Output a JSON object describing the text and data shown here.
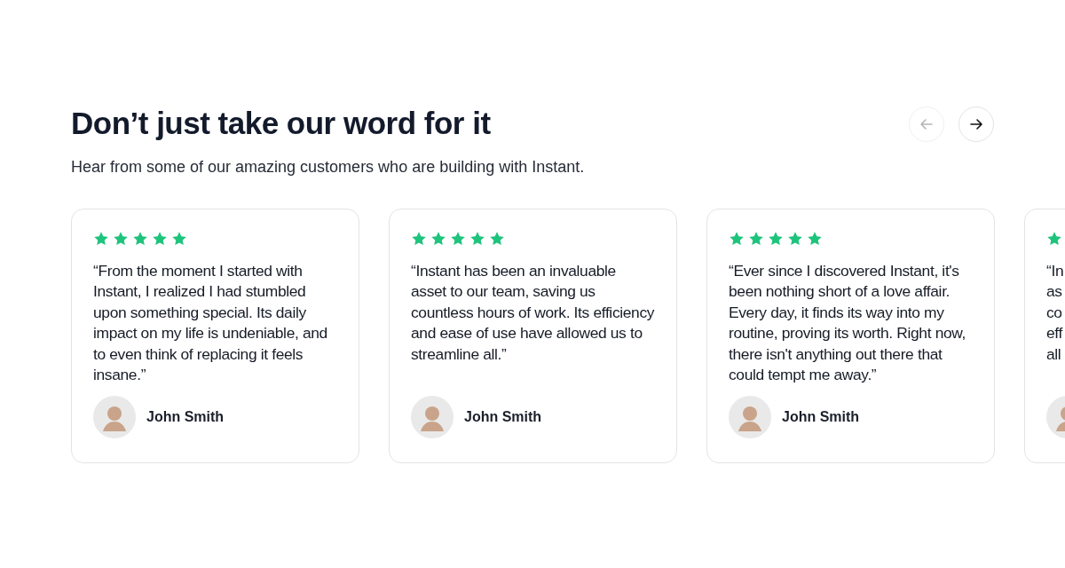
{
  "heading": "Don’t just take our word for it",
  "subheading": "Hear from some of our amazing customers who are building with Instant.",
  "nav": [
    {
      "kind": "prev",
      "disabled": true
    },
    {
      "kind": "next",
      "disabled": false
    }
  ],
  "testimonials": [
    {
      "stars": 5,
      "quote": "“From the moment I started with Instant, I realized I had stumbled upon something special. Its daily impact on my life is undeniable, and to even think of replacing it feels insane.”",
      "name": "John Smith"
    },
    {
      "stars": 5,
      "quote": "“Instant has been an invaluable asset to our team, saving us countless hours of work. Its efficiency and ease of use have allowed us to streamline all.”",
      "name": "John Smith"
    },
    {
      "stars": 5,
      "quote": "“Ever since I discovered Instant, it's been nothing short of a love affair. Every day, it finds its way into my routine, proving its worth. Right now, there isn't anything out there that could tempt me away.”",
      "name": "John Smith"
    },
    {
      "quote_lines": [
        "“In",
        "as",
        "co",
        "eff",
        "all"
      ]
    }
  ]
}
